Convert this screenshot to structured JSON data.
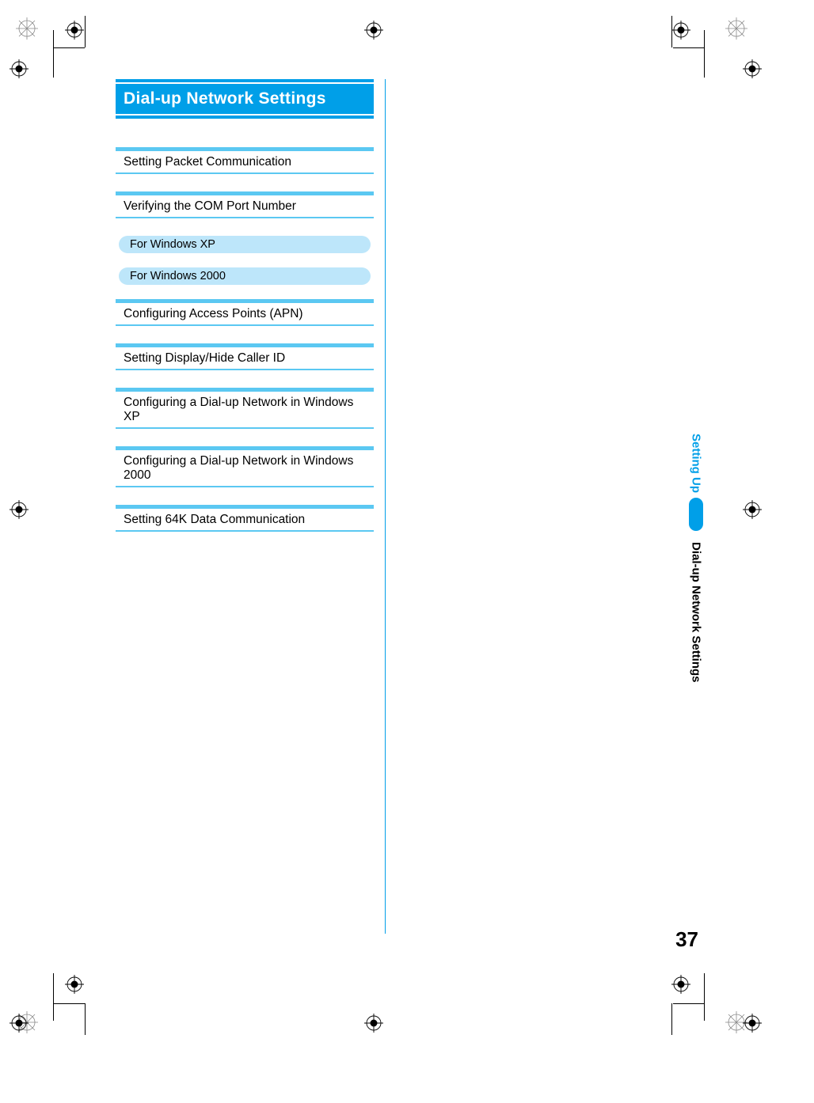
{
  "page": {
    "title": "Dial-up Network Settings",
    "sections": [
      "Setting Packet Communication",
      "Verifying the COM Port Number"
    ],
    "subpills": [
      "For Windows XP",
      "For Windows 2000"
    ],
    "sections2": [
      "Configuring Access Points (APN)",
      "Setting Display/Hide Caller ID",
      "Configuring a Dial-up Network in Windows XP",
      "Configuring a Dial-up Network in Windows 2000",
      "Setting 64K Data Communication"
    ],
    "sidebar": {
      "chapter": "Setting Up",
      "topic": "Dial-up Network Settings"
    },
    "page_number": "37"
  },
  "colors": {
    "accent": "#009fe8",
    "accent_light": "#5bc8f2",
    "pill_bg": "#bde6fa"
  }
}
